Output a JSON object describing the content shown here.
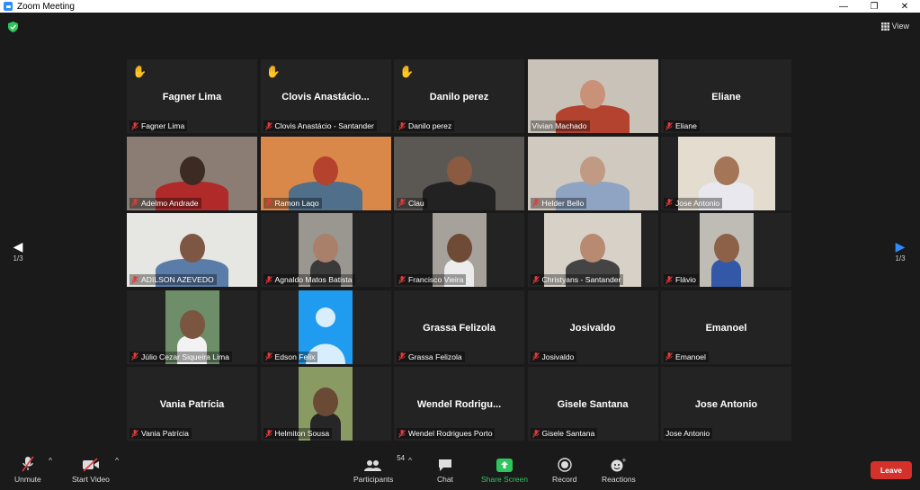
{
  "window": {
    "title": "Zoom Meeting",
    "minimize": "—",
    "restore": "❐",
    "close": "✕"
  },
  "view_label": "View",
  "pager": {
    "left": "1/3",
    "right": "1/3"
  },
  "participants": [
    {
      "big": "Fagner Lima",
      "label": "Fagner Lima",
      "hand": true,
      "muted": true,
      "video": false
    },
    {
      "big": "Clovis  Anastácio...",
      "label": "Clovis Anastácio - Santander",
      "hand": true,
      "muted": true,
      "video": false
    },
    {
      "big": "Danilo perez",
      "label": "Danilo perez",
      "hand": true,
      "muted": true,
      "video": false
    },
    {
      "big": "",
      "label": "Vivian Machado",
      "hand": false,
      "muted": false,
      "video": true,
      "active": true,
      "bg": "#c9c2b8",
      "skin": "#c99278",
      "shirt": "#b3432f",
      "full": true
    },
    {
      "big": "Eliane",
      "label": "Eliane",
      "hand": false,
      "muted": true,
      "video": false
    },
    {
      "big": "",
      "label": "Adelmo Andrade",
      "muted": true,
      "video": true,
      "bg": "#8b7d74",
      "skin": "#3d2a22",
      "shirt": "#b02a2a",
      "full": true
    },
    {
      "big": "",
      "label": "Ramon Laqo",
      "muted": true,
      "video": true,
      "bg": "#d9884a",
      "skin": "#b5422c",
      "shirt": "#4f6f8a",
      "full": true
    },
    {
      "big": "",
      "label": "Clau",
      "muted": true,
      "video": true,
      "bg": "#5b5853",
      "skin": "#8a5b40",
      "shirt": "#222",
      "full": true
    },
    {
      "big": "",
      "label": "Helder Bello",
      "muted": true,
      "video": true,
      "bg": "#cfc9bf",
      "skin": "#c19a84",
      "shirt": "#8ea4c2",
      "full": true
    },
    {
      "big": "",
      "label": "Jose Antonio",
      "muted": true,
      "video": true,
      "bg": "#e3dccf",
      "skin": "#a57558",
      "shirt": "#e8e8ee",
      "w": 108
    },
    {
      "big": "",
      "label": "ADILSON AZEVEDO",
      "muted": true,
      "video": true,
      "bg": "#e6e6e2",
      "skin": "#7e5644",
      "shirt": "#5a7ca8",
      "full": true
    },
    {
      "big": "",
      "label": "Agnaldo Matos Batista",
      "muted": true,
      "video": true,
      "bg": "#9a9791",
      "skin": "#a9806a",
      "shirt": "#3a3a3a",
      "w": 60
    },
    {
      "big": "",
      "label": "Francisco Vieira",
      "muted": true,
      "video": true,
      "bg": "#a6a29b",
      "skin": "#6f4a36",
      "shirt": "#ececec",
      "w": 60
    },
    {
      "big": "",
      "label": "Christyans - Santander",
      "muted": true,
      "video": true,
      "bg": "#d7d1c8",
      "skin": "#b78a71",
      "shirt": "#444",
      "w": 108
    },
    {
      "big": "",
      "label": "Flávio",
      "muted": true,
      "video": true,
      "bg": "#bfbcb6",
      "skin": "#8c6148",
      "shirt": "#3458a8",
      "w": 60
    },
    {
      "big": "",
      "label": "Júlio Cezar Siqueira Lima",
      "muted": true,
      "video": true,
      "bg": "#6e8e6a",
      "skin": "#7a553f",
      "shirt": "#f2f2f2",
      "w": 60
    },
    {
      "big": "",
      "label": "Edson Felix",
      "muted": true,
      "video": true,
      "avatar": true,
      "w": 60
    },
    {
      "big": "Grassa Felizola",
      "label": "Grassa Felizola",
      "muted": true,
      "video": false
    },
    {
      "big": "Josivaldo",
      "label": "Josivaldo",
      "muted": true,
      "video": false
    },
    {
      "big": "Emanoel",
      "label": "Emanoel",
      "muted": true,
      "video": false
    },
    {
      "big": "Vania Patrícia",
      "label": "Vania Patrícia",
      "muted": true,
      "video": false
    },
    {
      "big": "",
      "label": "Helmiton Sousa",
      "muted": true,
      "video": true,
      "bg": "#8a9a63",
      "skin": "#6b4a35",
      "shirt": "#262626",
      "w": 60
    },
    {
      "big": "Wendel  Rodrigu...",
      "label": "Wendel Rodrigues Porto",
      "muted": true,
      "video": false
    },
    {
      "big": "Gisele Santana",
      "label": "Gisele Santana",
      "muted": true,
      "video": false
    },
    {
      "big": "Jose Antonio",
      "label": "Jose Antonio",
      "muted": false,
      "video": false
    }
  ],
  "toolbar": {
    "unmute": "Unmute",
    "start_video": "Start Video",
    "participants": "Participants",
    "participants_count": "54",
    "chat": "Chat",
    "share_screen": "Share Screen",
    "record": "Record",
    "reactions": "Reactions",
    "leave": "Leave"
  },
  "colors": {
    "accent": "#2d8cff",
    "active_speaker": "#c2e36b",
    "share": "#2ec65b",
    "leave": "#d3312a",
    "muted": "#e03b3b",
    "hand": "#f7c23e"
  }
}
